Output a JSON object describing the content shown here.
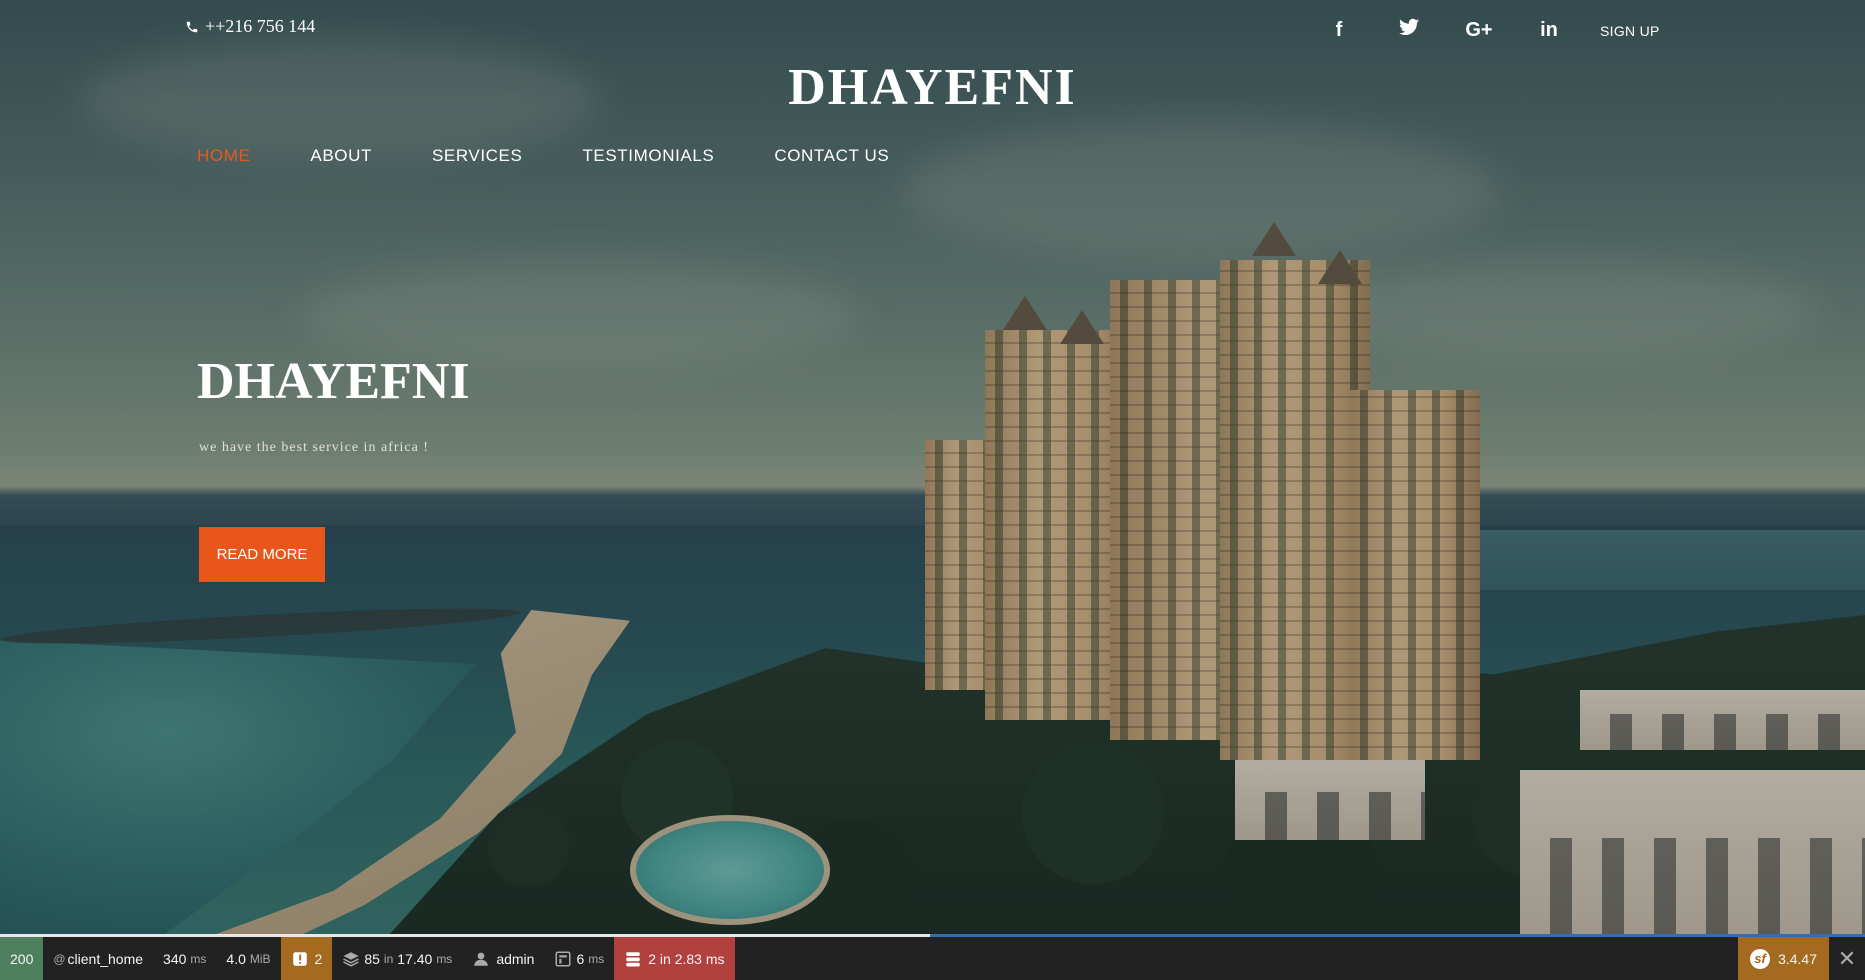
{
  "topbar": {
    "phone": "++216 756 144",
    "social": [
      {
        "icon": "facebook-icon",
        "glyph": "f"
      },
      {
        "icon": "twitter-icon",
        "glyph": "t"
      },
      {
        "icon": "google-plus-icon",
        "glyph": "G+"
      },
      {
        "icon": "linkedin-icon",
        "glyph": "in"
      }
    ],
    "signup": "SIGN UP"
  },
  "logo": "DHAYEFNI",
  "nav": {
    "items": [
      {
        "label": "HOME",
        "active": true
      },
      {
        "label": "ABOUT",
        "active": false
      },
      {
        "label": "SERVICES",
        "active": false
      },
      {
        "label": "TESTIMONIALS",
        "active": false
      },
      {
        "label": "CONTACT US",
        "active": false
      }
    ]
  },
  "hero": {
    "title": "DHAYEFNI",
    "subtitle": "we have the best service in africa !",
    "button": "READ MORE"
  },
  "debug_toolbar": {
    "status_code": "200",
    "route_prefix": "@",
    "route": "client_home",
    "time_value": "340",
    "time_unit": "ms",
    "memory_value": "4.0",
    "memory_unit": "MiB",
    "warnings": "2",
    "twig_count": "85",
    "twig_in": "in",
    "twig_time": "17.40",
    "twig_unit": "ms",
    "user": "admin",
    "cache_value": "6",
    "cache_unit": "ms",
    "db_queries": "2 in 2.83 ms",
    "symfony_version": "3.4.47",
    "colors": {
      "status": "#4f805d",
      "warning": "#a46a1f",
      "error": "#b0413e",
      "accent": "#e8561c"
    }
  }
}
